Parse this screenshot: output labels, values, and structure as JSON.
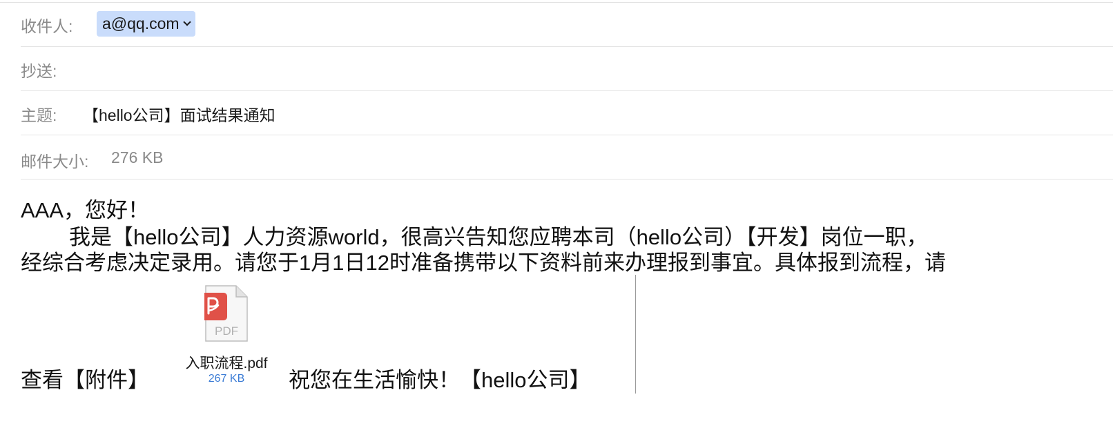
{
  "header": {
    "to_label": "收件人:",
    "to_value": "a@qq.com",
    "cc_label": "抄送:",
    "subject_label": "主题:",
    "subject_value": "【hello公司】面试结果通知",
    "size_label": "邮件大小:",
    "size_value": "276 KB"
  },
  "body": {
    "greeting": "AAA，您好！",
    "line1": "我是【hello公司】人力资源world，很高兴告知您应聘本司（hello公司）【开发】岗位一职，",
    "line2": "经综合考虑决定录用。请您于1月1日12时准备携带以下资料前来办理报到事宜。具体报到流程，请",
    "view_attachment": "查看【附件】",
    "closing": "祝您在生活愉快！【hello公司】"
  },
  "attachment": {
    "name": "入职流程.pdf",
    "size": "267 KB",
    "type_label": "PDF",
    "icon": "pdf-file-icon",
    "badge_color": "#e05148"
  }
}
